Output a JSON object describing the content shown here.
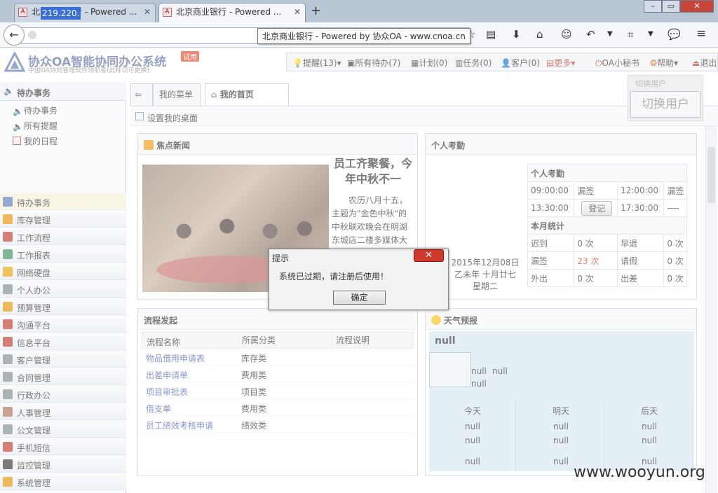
{
  "browser": {
    "tabs": [
      {
        "title": "北京商业银行 - Powered ...",
        "active": false
      },
      {
        "title": "北京商业银行 - Powered ...",
        "active": true
      }
    ],
    "new_tab": "+",
    "url": "219.220.",
    "tooltip": "北京商业银行 - Powered by 协众OA - www.cnoa.cn",
    "window_buttons": [
      "–",
      "▭",
      "✕"
    ]
  },
  "app": {
    "logo_text": "协众OA智能协同办公系统",
    "logo_sub": "中国OA协同管理软件领航者(此标识可更换)",
    "trial_badge": "试用",
    "toolbar": [
      {
        "label": "提醒(13)",
        "icon": "bulb-icon",
        "dropdown": true
      },
      {
        "label": "所有待办(7)",
        "icon": "todo-icon",
        "dropdown": false
      },
      {
        "label": "计划(0)",
        "icon": "plan-icon",
        "dropdown": false
      },
      {
        "label": "任务(0)",
        "icon": "task-icon",
        "dropdown": false
      },
      {
        "label": "客户(0)",
        "icon": "customer-icon",
        "dropdown": false
      },
      {
        "label": "更多",
        "icon": "more-icon",
        "dropdown": true
      },
      {
        "label": "OA小秘书",
        "icon": "power-icon",
        "dropdown": false
      },
      {
        "label": "帮助",
        "icon": "help-icon",
        "dropdown": true
      },
      {
        "label": "退出",
        "icon": "exit-icon",
        "dropdown": false
      }
    ],
    "switch_user_small": "切换用户",
    "switch_user_button": "切换用户"
  },
  "sidebar": {
    "header": "待办事务",
    "sub_items": [
      "待办事务",
      "所有提醒",
      "我的日程"
    ],
    "menu": [
      "待办事务",
      "库存管理",
      "工作流程",
      "工作报表",
      "网络硬盘",
      "个人办公",
      "预算管理",
      "沟通平台",
      "信息平台",
      "客户管理",
      "合同管理",
      "行政办公",
      "人事管理",
      "公文管理",
      "手机短信",
      "监控管理",
      "系统管理"
    ]
  },
  "main": {
    "tab_menu": "我的菜单",
    "tab_home": "我的首页",
    "set_desktop": "设置我的桌面",
    "news": {
      "title": "焦点新闻",
      "headline": "员工齐聚餐，今年中秋不一",
      "body": "农历八月十五，主题为\"金色中秋\"的中秋联欢晚会在明湖东城店二楼多媒体大厅隆重开幕，公司各部"
    },
    "attendance": {
      "title": "个人考勤",
      "date_line1": "2015年12月08日",
      "date_line2": "乙未年 十月廿七",
      "date_line3": "星期二",
      "table_title": "个人考勤",
      "rows": [
        [
          "09:00:00",
          "漏签",
          "12:00:00",
          "漏签"
        ],
        [
          "13:30:00",
          "登记",
          "17:30:00",
          "----"
        ]
      ],
      "month_title": "本月统计",
      "stats": [
        [
          "迟到",
          "0 次",
          "早退",
          "0 次"
        ],
        [
          "漏签",
          "23 次",
          "请假",
          "0 次"
        ],
        [
          "外出",
          "0 次",
          "出差",
          "0 次"
        ]
      ]
    },
    "flow": {
      "title": "流程发起",
      "headers": [
        "流程名称",
        "所属分类",
        "流程说明"
      ],
      "rows": [
        [
          "物品借用申请表",
          "库存类"
        ],
        [
          "出差申请单",
          "费用类"
        ],
        [
          "项目审批表",
          "项目类"
        ],
        [
          "借支单",
          "费用类"
        ],
        [
          "员工绩效考核申请",
          "绩效类"
        ]
      ]
    },
    "weather": {
      "title": "天气预报",
      "city": "null",
      "cur1": "null",
      "cur2": "null",
      "cur3": "null",
      "days": [
        {
          "label": "今天",
          "a": "null",
          "b": "null",
          "c": "null"
        },
        {
          "label": "明天",
          "a": "null",
          "b": "null",
          "c": "null"
        },
        {
          "label": "后天",
          "a": "null",
          "b": "null",
          "c": "null"
        }
      ]
    }
  },
  "dialog": {
    "title": "提示",
    "close": "✕",
    "message": "系统已过期，请注册后使用！",
    "ok": "确定"
  },
  "watermark": "www.wooyun.org",
  "colors": {
    "accent": "#5d6fa3",
    "danger": "#d0392b",
    "link": "#4a5fc1"
  }
}
